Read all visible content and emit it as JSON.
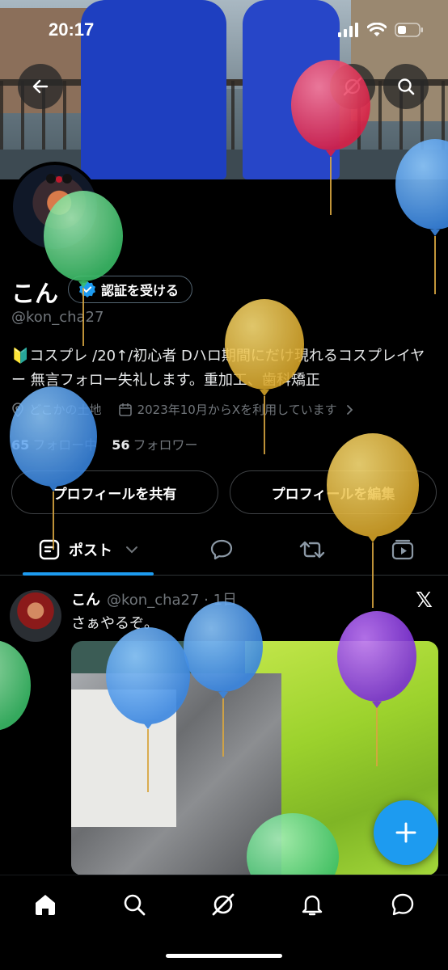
{
  "status_bar": {
    "time": "20:17"
  },
  "header": {
    "back_icon": "arrow-left-icon",
    "grok_icon": "grok-icon",
    "search_icon": "search-icon"
  },
  "profile": {
    "name": "こん",
    "verify_label": "認証を受ける",
    "handle": "@kon_cha27",
    "bio": "🔰コスプレ /20↑/初心者 Dハロ期間にだけ現れるコスプレイヤー 無言フォロー失礼します。重加工、歯科矯正",
    "location": "どこかの土地",
    "joined": "2023年10月からXを利用しています",
    "following_count": "65",
    "following_label": "フォロー中",
    "followers_count": "56",
    "followers_label": "フォロワー",
    "share_button": "プロフィールを共有",
    "edit_button": "プロフィールを編集"
  },
  "tabs": {
    "posts_label": "ポスト"
  },
  "post": {
    "author": "こん",
    "meta": "@kon_cha27 · 1日",
    "text": "さぁやるぞ。"
  },
  "colors": {
    "accent": "#1d9bf0",
    "background": "#000000",
    "muted": "#71767b"
  }
}
